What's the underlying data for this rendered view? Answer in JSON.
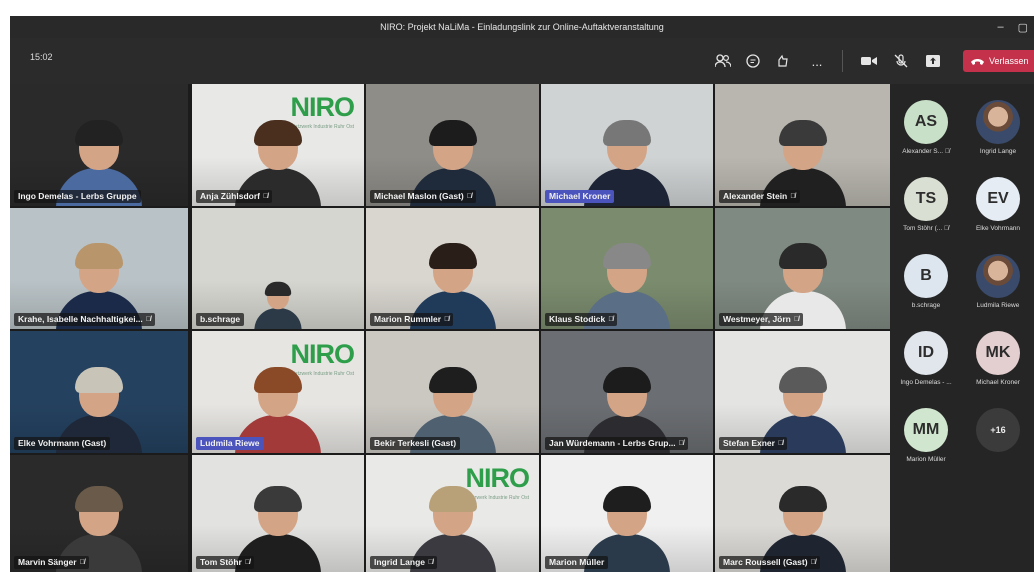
{
  "window": {
    "title": "NIRO: Projekt NaLiMa - Einladungslink zur Online-Auftaktveranstaltung",
    "minimize": "–",
    "maximize": "▢"
  },
  "toolbar": {
    "time": "15:02",
    "leave_label": "Verlassen",
    "more_label": "..."
  },
  "tiles": [
    {
      "name": "Ingo Demelas - Lerbs Gruppe",
      "muted": false,
      "highlight": false,
      "bg": "#2a2a2a",
      "shirt": "#4a6aa0",
      "hair": "#222222"
    },
    {
      "name": "Anja Zühlsdorf",
      "muted": true,
      "highlight": false,
      "bg": "#e8e8e6",
      "shirt": "#2b2b2b",
      "hair": "#4a2e1e",
      "logo": "NIRO",
      "logo_sub": "Netzwerk Industrie Ruhr Ost"
    },
    {
      "name": "Michael Maslon (Gast)",
      "muted": true,
      "highlight": false,
      "bg": "#8f8d88",
      "shirt": "#1f2a3a",
      "hair": "#1c1c1c"
    },
    {
      "name": "Michael Kroner",
      "muted": false,
      "highlight": true,
      "bg": "#cfd3d4",
      "shirt": "#1c2436",
      "hair": "#777777"
    },
    {
      "name": "Alexander Stein",
      "muted": true,
      "highlight": false,
      "bg": "#b8b6ae",
      "shirt": "#202020",
      "hair": "#3a3a3a"
    },
    {
      "name": "Krahe, Isabelle Nachhaltigkei...",
      "muted": true,
      "highlight": false,
      "bg": "#b9c2c6",
      "shirt": "#1a2a48",
      "hair": "#b8956a"
    },
    {
      "name": "b.schrage",
      "muted": false,
      "highlight": false,
      "bg": "#d5d6cf",
      "shirt": "#2c3a48",
      "hair": "#2a2a2a",
      "small": true
    },
    {
      "name": "Marion Rummler",
      "muted": true,
      "highlight": false,
      "bg": "#d9d6d0",
      "shirt": "#203a5a",
      "hair": "#2a1e18"
    },
    {
      "name": "Klaus Stodick",
      "muted": true,
      "highlight": false,
      "bg": "#7b8c6e",
      "shirt": "#5a6e86",
      "hair": "#888888"
    },
    {
      "name": "Westmeyer, Jörn",
      "muted": true,
      "highlight": false,
      "bg": "#7f8a82",
      "shirt": "#e8e8e8",
      "hair": "#2a2a2a"
    },
    {
      "name": "Elke Vohrmann (Gast)",
      "muted": false,
      "highlight": false,
      "bg": "#24415f",
      "shirt": "#1f2838",
      "hair": "#c8c4b8"
    },
    {
      "name": "Ludmila Riewe",
      "muted": false,
      "highlight": true,
      "bg": "#e6e5e2",
      "shirt": "#a23a3a",
      "hair": "#8a4a28",
      "logo": "NIRO",
      "logo_sub": "Netzwerk Industrie Ruhr Ost"
    },
    {
      "name": "Bekir Terkesli (Gast)",
      "muted": false,
      "highlight": false,
      "bg": "#cbc8c2",
      "shirt": "#4f6070",
      "hair": "#1e1e1e"
    },
    {
      "name": "Jan Würdemann - Lerbs Grup...",
      "muted": true,
      "highlight": false,
      "bg": "#6b6e72",
      "shirt": "#2c2c30",
      "hair": "#1c1c1c"
    },
    {
      "name": "Stefan Exner",
      "muted": true,
      "highlight": false,
      "bg": "#e4e4e2",
      "shirt": "#2a3a5a",
      "hair": "#5a5a5a"
    },
    {
      "name": "Marvin Sänger",
      "muted": true,
      "highlight": false,
      "bg": "#2a2a2a",
      "shirt": "#3a3a3a",
      "hair": "#6a5a4a"
    },
    {
      "name": "Tom Stöhr",
      "muted": true,
      "highlight": false,
      "bg": "#e2e2e0",
      "shirt": "#1e1e1e",
      "hair": "#3a3a3a"
    },
    {
      "name": "Ingrid Lange",
      "muted": true,
      "highlight": false,
      "bg": "#e9e9e7",
      "shirt": "#3a3a40",
      "hair": "#b8a078",
      "logo": "NIRO",
      "logo_sub": "Netzwerk Industrie Ruhr Ost"
    },
    {
      "name": "Marion Müller",
      "muted": false,
      "highlight": false,
      "bg": "#f0f0f0",
      "shirt": "#2a3a4a",
      "hair": "#1e1e1e"
    },
    {
      "name": "Marc Roussell (Gast)",
      "muted": true,
      "highlight": false,
      "bg": "#dcdad6",
      "shirt": "#1e2430",
      "hair": "#2a2a2a"
    }
  ],
  "participants": [
    {
      "initials": "AS",
      "name": "Alexander S...",
      "color": "#c9e0c8",
      "muted": true
    },
    {
      "initials": "",
      "name": "Ingrid Lange",
      "color": "#d8c6b0",
      "muted": false,
      "photo": true
    },
    {
      "initials": "TS",
      "name": "Tom Stöhr (...",
      "color": "#d9dfd2",
      "muted": true
    },
    {
      "initials": "EV",
      "name": "Elke Vohrmann",
      "color": "#e6ecf4",
      "muted": false
    },
    {
      "initials": "B",
      "name": "b.schrage",
      "color": "#dde6ee",
      "muted": false
    },
    {
      "initials": "",
      "name": "Ludmila Riewe",
      "color": "#cdbfb2",
      "muted": false,
      "photo": true
    },
    {
      "initials": "ID",
      "name": "Ingo Demelas - ...",
      "color": "#e1e6ec",
      "muted": false
    },
    {
      "initials": "MK",
      "name": "Michael Kroner",
      "color": "#e4cfd0",
      "muted": false
    },
    {
      "initials": "MM",
      "name": "Marion Müller",
      "color": "#d1e6cf",
      "muted": false
    },
    {
      "initials": "+16",
      "name": "",
      "color": "#3b3b3b",
      "muted": false,
      "more": true
    }
  ]
}
